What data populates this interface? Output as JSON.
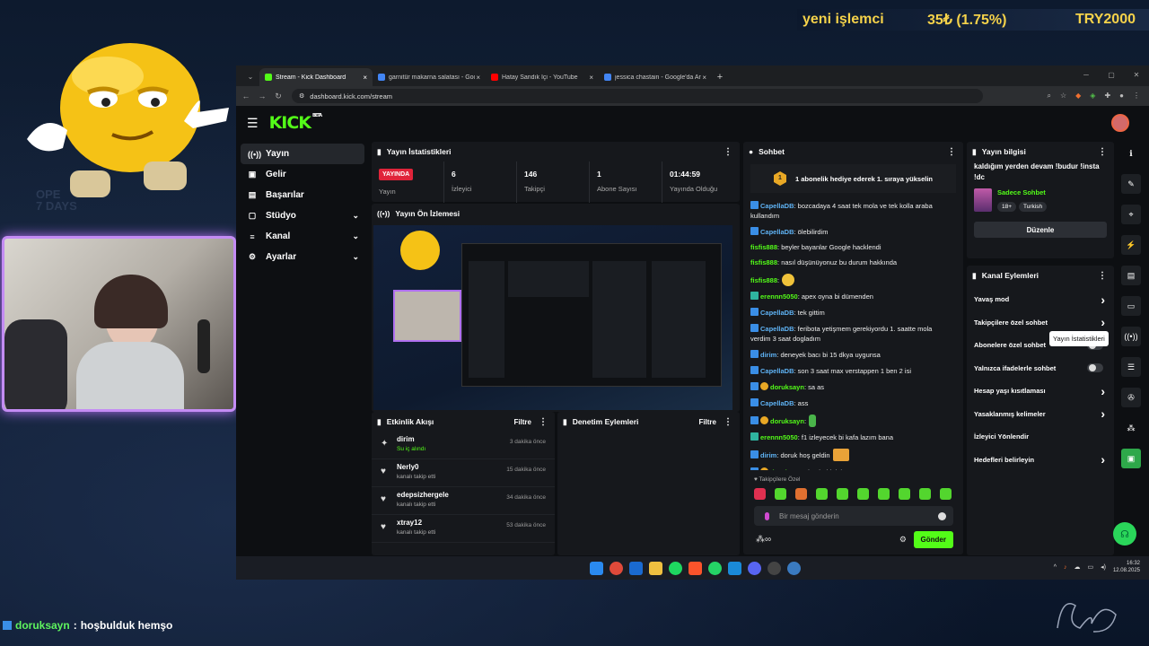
{
  "overlay": {
    "ticker": {
      "item": "yeni işlemci",
      "change": "35₺ (1.75%)",
      "target": "TRY2000"
    },
    "bg_text": "OPE\n7 DAYS",
    "chat_user": "doruksayn",
    "chat_sep": ":",
    "chat_msg": "hoşbulduk hemşo"
  },
  "browser": {
    "tabs": [
      {
        "label": "Stream - Kick Dashboard",
        "active": true,
        "color": "#53fc18"
      },
      {
        "label": "garnitür makarna salatası - Goo",
        "active": false,
        "color": "#4285f4"
      },
      {
        "label": "Hatay Sandık İçi - YouTube",
        "active": false,
        "color": "#ff0000"
      },
      {
        "label": "jessica chastain - Google'da Ara",
        "active": false,
        "color": "#4285f4"
      }
    ],
    "new_tab": "+",
    "close": "×",
    "url": "dashboard.kick.com/stream"
  },
  "kick": {
    "logo": "KICK",
    "beta": "BETA",
    "sidebar": [
      {
        "label": "Yayın",
        "icon": "((•))",
        "active": true,
        "chevron": false
      },
      {
        "label": "Gelir",
        "icon": "▣",
        "active": false,
        "chevron": false
      },
      {
        "label": "Başarılar",
        "icon": "▤",
        "active": false,
        "chevron": false
      },
      {
        "label": "Stüdyo",
        "icon": "▢",
        "active": false,
        "chevron": true
      },
      {
        "label": "Kanal",
        "icon": "≡",
        "active": false,
        "chevron": true
      },
      {
        "label": "Ayarlar",
        "icon": "⚙",
        "active": false,
        "chevron": true
      }
    ],
    "stats": {
      "title": "Yayın İstatistikleri",
      "live_badge": "YAYINDA",
      "items": [
        {
          "label": "Yayın",
          "value": ""
        },
        {
          "label": "İzleyici",
          "value": "6"
        },
        {
          "label": "Takipçi",
          "value": "146"
        },
        {
          "label": "Abone Sayısı",
          "value": "1"
        },
        {
          "label": "Yayında Olduğu",
          "value": "01:44:59"
        }
      ]
    },
    "preview": {
      "title": "Yayın Ön İzlemesi"
    },
    "activity": {
      "title": "Etkinlik Akışı",
      "filter": "Filtre",
      "items": [
        {
          "name": "dirim",
          "desc": "Su iç alındı",
          "time": "3 dakika önce",
          "green": true,
          "icon": "✦"
        },
        {
          "name": "Nerly0",
          "desc": "kanalı takip etti",
          "time": "15 dakika önce",
          "green": false,
          "icon": "♥"
        },
        {
          "name": "edepsizhergele",
          "desc": "kanalı takip etti",
          "time": "34 dakika önce",
          "green": false,
          "icon": "♥"
        },
        {
          "name": "xtray12",
          "desc": "kanalı takip etti",
          "time": "53 dakika önce",
          "green": false,
          "icon": "♥"
        }
      ]
    },
    "moderation": {
      "title": "Denetim Eylemleri",
      "filter": "Filtre"
    },
    "chat": {
      "title": "Sohbet",
      "pinned": "1 abonelik hediye ederek 1. sıraya yükselin",
      "pinned_rank": "1",
      "messages": [
        {
          "user": "CapellaDB",
          "color": "#5fb3f5",
          "badge": "bi",
          "text": ": bozcadaya 4 saat tek mola ve tek kolla araba kullandım"
        },
        {
          "user": "CapellaDB",
          "color": "#5fb3f5",
          "badge": "bi",
          "text": ": ölebilirdim"
        },
        {
          "user": "fisfis888",
          "color": "#53fc18",
          "badge": "",
          "text": ": beyler bayanlar Google hacklendi"
        },
        {
          "user": "fisfis888",
          "color": "#53fc18",
          "badge": "",
          "text": ": nasıl düşünüyonuz bu durum hakkında"
        },
        {
          "user": "fisfis888",
          "color": "#53fc18",
          "badge": "",
          "text": ":",
          "emote": "emo"
        },
        {
          "user": "erennn5050",
          "color": "#53fc18",
          "badge": "bg2",
          "text": ": apex oyna bi dümenden"
        },
        {
          "user": "CapellaDB",
          "color": "#5fb3f5",
          "badge": "bi",
          "text": ": tek gittim"
        },
        {
          "user": "CapellaDB",
          "color": "#5fb3f5",
          "badge": "bi",
          "text": ": feribota yetişmem gerekiyordu 1. saatte mola verdim 3 saat dogladım"
        },
        {
          "user": "dirim",
          "color": "#5fb3f5",
          "badge": "bi",
          "text": ": deneyek bacı bi 15 dkya uygunsa"
        },
        {
          "user": "CapellaDB",
          "color": "#5fb3f5",
          "badge": "bi",
          "text": ": son 3 saat max verstappen 1 ben 2 isi"
        },
        {
          "user": "doruksayn",
          "color": "#53fc18",
          "badge": "bi bo",
          "text": ": sa as"
        },
        {
          "user": "CapellaDB",
          "color": "#5fb3f5",
          "badge": "bi",
          "text": ": ass"
        },
        {
          "user": "doruksayn",
          "color": "#53fc18",
          "badge": "bi bo",
          "text": ":",
          "emote": "emo gr"
        },
        {
          "user": "erennn5050",
          "color": "#53fc18",
          "badge": "bg2",
          "text": ": f1 izleyecek bi kafa lazım bana"
        },
        {
          "user": "dirim",
          "color": "#5fb3f5",
          "badge": "bi",
          "text": ": doruk hoş geldin",
          "emote": "emo sq"
        },
        {
          "user": "doruksayn",
          "color": "#53fc18",
          "badge": "bi bo",
          "text": ": hoşbulduk hemşo"
        }
      ],
      "followers_only": "♥ Takipçilere Özel",
      "input_placeholder": "Bir mesaj gönderin",
      "send_label": "Gönder"
    },
    "stream_info": {
      "title": "Yayın bilgisi",
      "stream_title": "kaldığım yerden devam !budur !insta !dc",
      "category": "Sadece Sohbet",
      "tags": [
        "18+",
        "Turkish"
      ],
      "edit_label": "Düzenle"
    },
    "channel_actions": {
      "title": "Kanal Eylemleri",
      "items": [
        {
          "label": "Yavaş mod",
          "kind": "chevron"
        },
        {
          "label": "Takipçilere özel sohbet",
          "kind": "chevron"
        },
        {
          "label": "Abonelere özel sohbet",
          "kind": "toggle"
        },
        {
          "label": "Yalnızca ifadelerle sohbet",
          "kind": "toggle"
        },
        {
          "label": "Hesap yaşı kısıtlaması",
          "kind": "chevron"
        },
        {
          "label": "Yasaklanmış kelimeler",
          "kind": "chevron"
        },
        {
          "label": "İzleyici Yönlendir",
          "kind": "none"
        },
        {
          "label": "Hedefleri belirleyin",
          "kind": "chevron"
        }
      ]
    },
    "tooltip": "Yayın İstatistikleri"
  },
  "taskbar": {
    "time": "16:32",
    "date": "12.08.2025"
  },
  "colors": {
    "accent": "#53fc18",
    "live": "#e0243a"
  }
}
